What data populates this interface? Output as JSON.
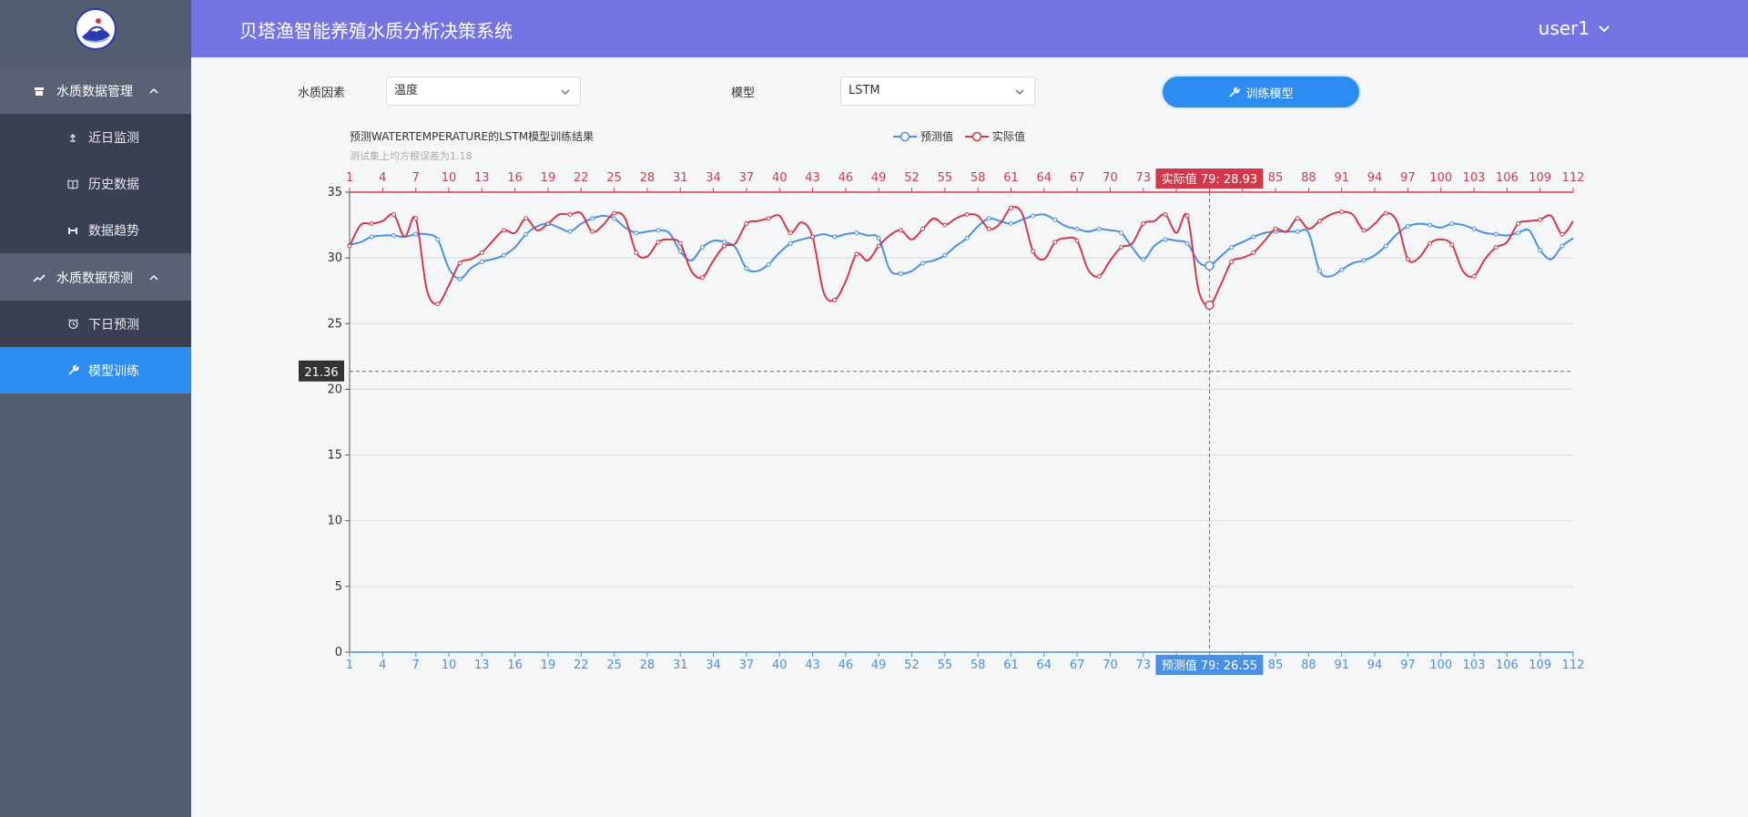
{
  "header": {
    "title": "贝塔渔智能养殖水质分析决策系统",
    "user": "user1"
  },
  "sidebar": {
    "groups": [
      {
        "label": "水质数据管理",
        "icon": "database-icon",
        "items": [
          {
            "label": "近日监测",
            "icon": "monitor-icon"
          },
          {
            "label": "历史数据",
            "icon": "book-icon"
          },
          {
            "label": "数据趋势",
            "icon": "trend-bar-icon"
          }
        ]
      },
      {
        "label": "水质数据预测",
        "icon": "trending-up-icon",
        "items": [
          {
            "label": "下日预测",
            "icon": "alarm-clock-icon"
          },
          {
            "label": "模型训练",
            "icon": "wrench-icon",
            "active": true
          }
        ]
      }
    ]
  },
  "form": {
    "factor_label": "水质因素",
    "factor_value": "温度",
    "model_label": "模型",
    "model_value": "LSTM",
    "train_button": "训练模型"
  },
  "colors": {
    "predicted": "#4a90e2",
    "actual": "#d1394b",
    "header": "#7475e3",
    "active": "#2d8cf0"
  },
  "chart_data": {
    "type": "line",
    "title": "预测WATERTEMPERATURE的LSTM模型训练结果",
    "subtitle": "测试集上均方根误差为1.18",
    "ylim": [
      0,
      35
    ],
    "y_ticks": [
      0,
      5,
      10,
      15,
      20,
      25,
      30,
      35
    ],
    "x_ticks": [
      1,
      4,
      7,
      10,
      13,
      16,
      19,
      22,
      25,
      28,
      31,
      34,
      37,
      40,
      43,
      46,
      49,
      52,
      55,
      58,
      61,
      64,
      67,
      70,
      73,
      76,
      79,
      82,
      85,
      88,
      91,
      94,
      97,
      100,
      103,
      106,
      109,
      112
    ],
    "x_count": 112,
    "legend": [
      "预测值",
      "实际值"
    ],
    "series": [
      {
        "name": "预测值",
        "values": [
          31.0,
          31.2,
          31.6,
          31.7,
          31.7,
          31.6,
          31.8,
          31.8,
          31.4,
          29.2,
          28.4,
          29.2,
          29.7,
          29.9,
          30.2,
          30.8,
          31.8,
          32.4,
          32.6,
          32.3,
          32.0,
          32.6,
          33.0,
          33.2,
          33.0,
          32.3,
          31.9,
          32.0,
          32.1,
          31.9,
          30.5,
          29.8,
          30.8,
          31.3,
          31.2,
          30.8,
          29.2,
          29.0,
          29.5,
          30.4,
          31.1,
          31.4,
          31.6,
          31.8,
          31.6,
          31.8,
          31.9,
          31.7,
          31.5,
          29.1,
          28.8,
          29.0,
          29.6,
          29.8,
          30.2,
          30.9,
          31.5,
          32.4,
          33.0,
          32.8,
          32.6,
          32.9,
          33.2,
          33.3,
          32.9,
          32.4,
          32.2,
          32.0,
          32.2,
          32.1,
          31.9,
          30.8,
          29.9,
          30.9,
          31.4,
          31.3,
          31.1,
          29.7,
          29.4,
          30.1,
          30.8,
          31.2,
          31.6,
          31.9,
          32.0,
          32.0,
          32.0,
          31.9,
          29.0,
          28.6,
          29.1,
          29.6,
          29.8,
          30.2,
          30.9,
          31.8,
          32.4,
          32.6,
          32.5,
          32.3,
          32.6,
          32.5,
          32.2,
          31.9,
          31.8,
          31.7,
          31.9,
          32.1,
          30.6,
          29.9,
          30.9,
          31.5
        ],
        "tooltip": "预测值  79:  26.55"
      },
      {
        "name": "实际值",
        "values": [
          30.9,
          32.5,
          32.6,
          32.8,
          33.3,
          31.6,
          33.0,
          27.6,
          26.5,
          27.9,
          29.6,
          29.9,
          30.4,
          31.3,
          32.1,
          31.9,
          33.0,
          32.1,
          32.6,
          33.3,
          33.3,
          33.4,
          32.0,
          32.5,
          33.4,
          33.0,
          30.4,
          30.1,
          31.2,
          31.4,
          31.1,
          29.0,
          28.5,
          29.8,
          30.9,
          31.1,
          32.6,
          32.8,
          33.0,
          33.2,
          31.9,
          32.7,
          31.6,
          27.4,
          26.8,
          28.2,
          30.3,
          29.8,
          30.9,
          31.7,
          32.1,
          31.4,
          32.2,
          33.0,
          32.5,
          33.0,
          33.3,
          33.2,
          32.2,
          32.6,
          33.8,
          33.4,
          30.5,
          29.9,
          31.2,
          31.5,
          31.3,
          29.1,
          28.6,
          29.8,
          30.8,
          31.1,
          32.6,
          32.8,
          33.3,
          31.9,
          33.2,
          27.6,
          26.4,
          27.9,
          29.7,
          30.0,
          30.4,
          31.3,
          32.2,
          32.0,
          33.0,
          32.2,
          32.8,
          33.3,
          33.5,
          33.3,
          32.1,
          32.6,
          33.4,
          32.8,
          29.9,
          30.0,
          31.1,
          31.4,
          31.0,
          29.0,
          28.6,
          29.9,
          30.8,
          31.2,
          32.6,
          32.8,
          32.9,
          33.2,
          31.8,
          32.8
        ],
        "tooltip": "实际值  79:  28.93"
      }
    ],
    "crosshair_x": 79,
    "crosshair_y_label": "21.36",
    "grid": true
  }
}
